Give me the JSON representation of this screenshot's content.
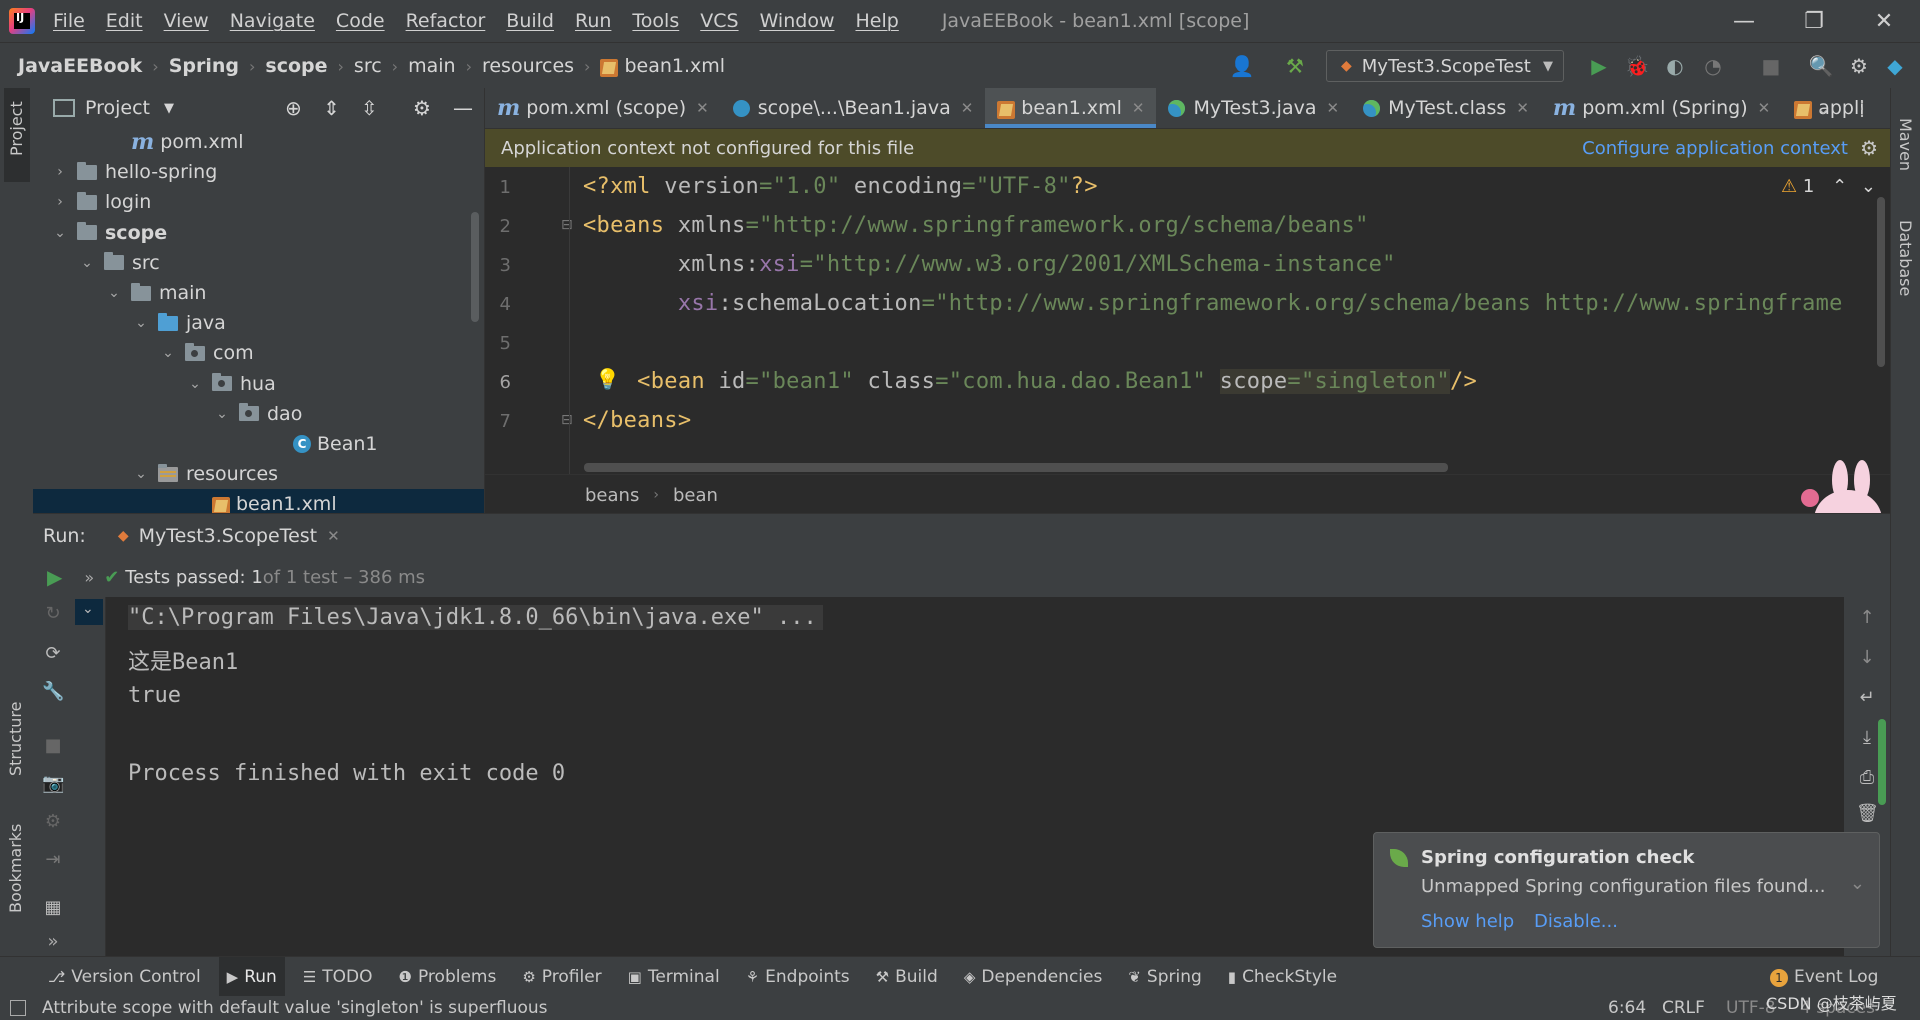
{
  "app": {
    "logo_text": "IJ",
    "menu": [
      "File",
      "Edit",
      "View",
      "Navigate",
      "Code",
      "Refactor",
      "Build",
      "Run",
      "Tools",
      "VCS",
      "Window",
      "Help"
    ],
    "window_title": "JavaEEBook - bean1.xml [scope]"
  },
  "navbar": {
    "breadcrumb": [
      "JavaEEBook",
      "Spring",
      "scope",
      "src",
      "main",
      "resources",
      "bean1.xml"
    ],
    "run_config": "MyTest3.ScopeTest"
  },
  "left_stripe": {
    "project_label": "Project",
    "structure_label": "Structure",
    "bookmarks_label": "Bookmarks"
  },
  "right_stripe": {
    "maven_label": "Maven",
    "database_label": "Database"
  },
  "project_panel": {
    "title": "Project",
    "tree": [
      {
        "label": "pom.xml",
        "icon": "maven-icon",
        "indent": 4,
        "chev": ""
      },
      {
        "label": "hello-spring",
        "icon": "folder-icon",
        "indent": 2,
        "chev": "right"
      },
      {
        "label": "login",
        "icon": "folder-icon",
        "indent": 2,
        "chev": "right"
      },
      {
        "label": "scope",
        "icon": "folder-icon",
        "indent": 2,
        "chev": "down",
        "bold": true
      },
      {
        "label": "src",
        "icon": "folder-icon",
        "indent": 3,
        "chev": "down"
      },
      {
        "label": "main",
        "icon": "folder-icon",
        "indent": 4,
        "chev": "down"
      },
      {
        "label": "java",
        "icon": "source-folder-icon",
        "indent": 5,
        "chev": "down"
      },
      {
        "label": "com",
        "icon": "package-icon",
        "indent": 6,
        "chev": "down"
      },
      {
        "label": "hua",
        "icon": "package-icon",
        "indent": 7,
        "chev": "down"
      },
      {
        "label": "dao",
        "icon": "package-icon",
        "indent": 8,
        "chev": "down"
      },
      {
        "label": "Bean1",
        "icon": "class-icon",
        "indent": 10,
        "chev": ""
      },
      {
        "label": "resources",
        "icon": "resources-folder-icon",
        "indent": 5,
        "chev": "down"
      },
      {
        "label": "bean1.xml",
        "icon": "xml-icon",
        "indent": 7,
        "chev": "",
        "selected": true
      }
    ]
  },
  "editor_tabs": [
    {
      "label": "pom.xml (scope)",
      "icon": "maven-icon",
      "active": false
    },
    {
      "label": "scope\\...\\Bean1.java",
      "icon": "class-icon",
      "active": false
    },
    {
      "label": "bean1.xml",
      "icon": "xml-icon",
      "active": true
    },
    {
      "label": "MyTest3.java",
      "icon": "test-class-icon",
      "active": false
    },
    {
      "label": "MyTest.class",
      "icon": "test-class-icon",
      "active": false
    },
    {
      "label": "pom.xml (Spring)",
      "icon": "maven-icon",
      "active": false
    },
    {
      "label": "appli",
      "icon": "xml-icon",
      "active": false
    }
  ],
  "banner": {
    "message": "Application context not configured for this file",
    "link": "Configure application context"
  },
  "editor": {
    "line_numbers": [
      "1",
      "2",
      "3",
      "4",
      "5",
      "6",
      "7"
    ],
    "warning_count": "1",
    "breadcrumb": [
      "beans",
      "bean"
    ],
    "code": {
      "l1_a": "<?xml",
      "l1_b": " version",
      "l1_c": "=",
      "l1_d": "\"1.0\"",
      "l1_e": " encoding",
      "l1_f": "=",
      "l1_g": "\"UTF-8\"",
      "l1_h": "?>",
      "l2_a": "<beans",
      "l2_b": " xmlns",
      "l2_c": "=",
      "l2_d": "\"http://www.springframework.org/schema/beans\"",
      "l3_a": "       xmlns",
      "l3_b": ":",
      "l3_c": "xsi",
      "l3_d": "=",
      "l3_e": "\"http://www.w3.org/2001/XMLSchema-instance\"",
      "l4_a": "       ",
      "l4_b": "xsi",
      "l4_c": ":schemaLocation",
      "l4_d": "=",
      "l4_e": "\"http://www.springframework.org/schema/beans http://www.springframe",
      "l6_a": "    <bean",
      "l6_b": " id",
      "l6_c": "=",
      "l6_d": "\"bean1\"",
      "l6_e": " class",
      "l6_f": "=",
      "l6_g": "\"com.hua.dao.Bean1\"",
      "l6_h": " ",
      "l6_i": "scope",
      "l6_j": "=",
      "l6_k": "\"singleton\"",
      "l6_l": "/>",
      "l7_a": "</beans>"
    }
  },
  "run_panel": {
    "label": "Run:",
    "tab": "MyTest3.ScopeTest",
    "status_prefix": "Tests passed: 1",
    "status_suffix": " of 1 test – 386 ms",
    "console": [
      "\"C:\\Program Files\\Java\\jdk1.8.0_66\\bin\\java.exe\" ...",
      "这是Bean1",
      "true",
      "",
      "Process finished with exit code 0"
    ]
  },
  "notification": {
    "title": "Spring configuration check",
    "body": "Unmapped Spring configuration files found...",
    "link_help": "Show help",
    "link_disable": "Disable..."
  },
  "bottom_tools": [
    {
      "label": "Version Control",
      "icon": "⎇",
      "active": false
    },
    {
      "label": "Run",
      "icon": "▶",
      "active": true
    },
    {
      "label": "TODO",
      "icon": "☰",
      "active": false
    },
    {
      "label": "Problems",
      "icon": "❶",
      "active": false
    },
    {
      "label": "Profiler",
      "icon": "⚙",
      "active": false
    },
    {
      "label": "Terminal",
      "icon": "▣",
      "active": false
    },
    {
      "label": "Endpoints",
      "icon": "⚘",
      "active": false
    },
    {
      "label": "Build",
      "icon": "⚒",
      "active": false
    },
    {
      "label": "Dependencies",
      "icon": "◈",
      "active": false
    },
    {
      "label": "Spring",
      "icon": "❦",
      "active": false
    },
    {
      "label": "CheckStyle",
      "icon": "▮",
      "active": false
    }
  ],
  "event_log": {
    "count": "1",
    "label": "Event Log"
  },
  "statusbar": {
    "message": "Attribute scope with default value 'singleton' is superfluous",
    "position": "6:64",
    "line_sep": "CRLF",
    "encoding": "UTF-8",
    "indent": "4 spaces",
    "watermark": "CSDN @枝茶屿夏"
  },
  "colors": {
    "accent": "#4a88c7",
    "link": "#589df6",
    "run_green": "#499c54",
    "xml_tag": "#e8bf6a",
    "string": "#6a8759"
  }
}
